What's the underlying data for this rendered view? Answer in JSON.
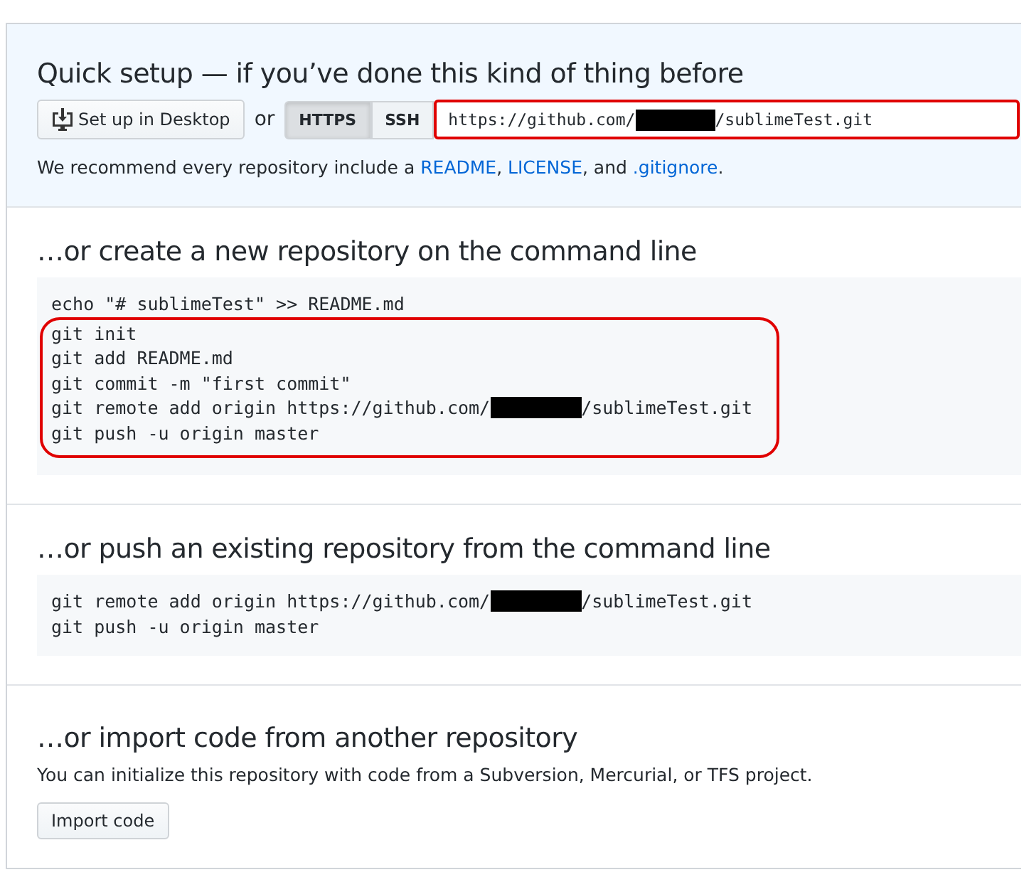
{
  "quick_setup": {
    "title": "Quick setup — if you’ve done this kind of thing before",
    "desktop_button": "Set up in Desktop",
    "or_label": "or",
    "protocols": [
      {
        "label": "HTTPS",
        "selected": true
      },
      {
        "label": "SSH",
        "selected": false
      }
    ],
    "url_field": {
      "value": "https://github.com/",
      "redacted": true,
      "rest": "/sublimeTest.git",
      "highlighted": true
    },
    "recommend": "We recommend every repository include a ",
    "links": [
      "README",
      "LICENSE"
    ],
    "link_separator": ", ",
    "and_text": ", and ",
    "last_link": ".gitignore",
    "end_text": "."
  },
  "sections": [
    {
      "kind": "code",
      "title": "…or create a new repository on the command line",
      "lines": [
        {
          "text": "echo \"# sublimeTest\" >> README.md",
          "highlighted": false
        },
        {
          "text": "git init",
          "highlighted": true
        },
        {
          "text": "git add README.md",
          "highlighted": true
        },
        {
          "text": "git commit -m \"first commit\"",
          "highlighted": true
        },
        {
          "text": "git remote add origin https://github.com/",
          "redacted": true,
          "rest": "/sublimeTest.git",
          "highlighted": true
        },
        {
          "text": "git push -u origin master",
          "highlighted": true
        }
      ]
    },
    {
      "kind": "code",
      "title": "…or push an existing repository from the command line",
      "lines": [
        {
          "text": "git remote add origin https://github.com/",
          "redacted": true,
          "rest": "/sublimeTest.git",
          "highlighted": false
        },
        {
          "text": "git push -u origin master",
          "highlighted": false
        }
      ]
    },
    {
      "kind": "import",
      "title": "…or import code from another repository",
      "text": "You can initialize this repository with code from a Subversion, Mercurial, or TFS project.",
      "button": "Import code"
    }
  ]
}
